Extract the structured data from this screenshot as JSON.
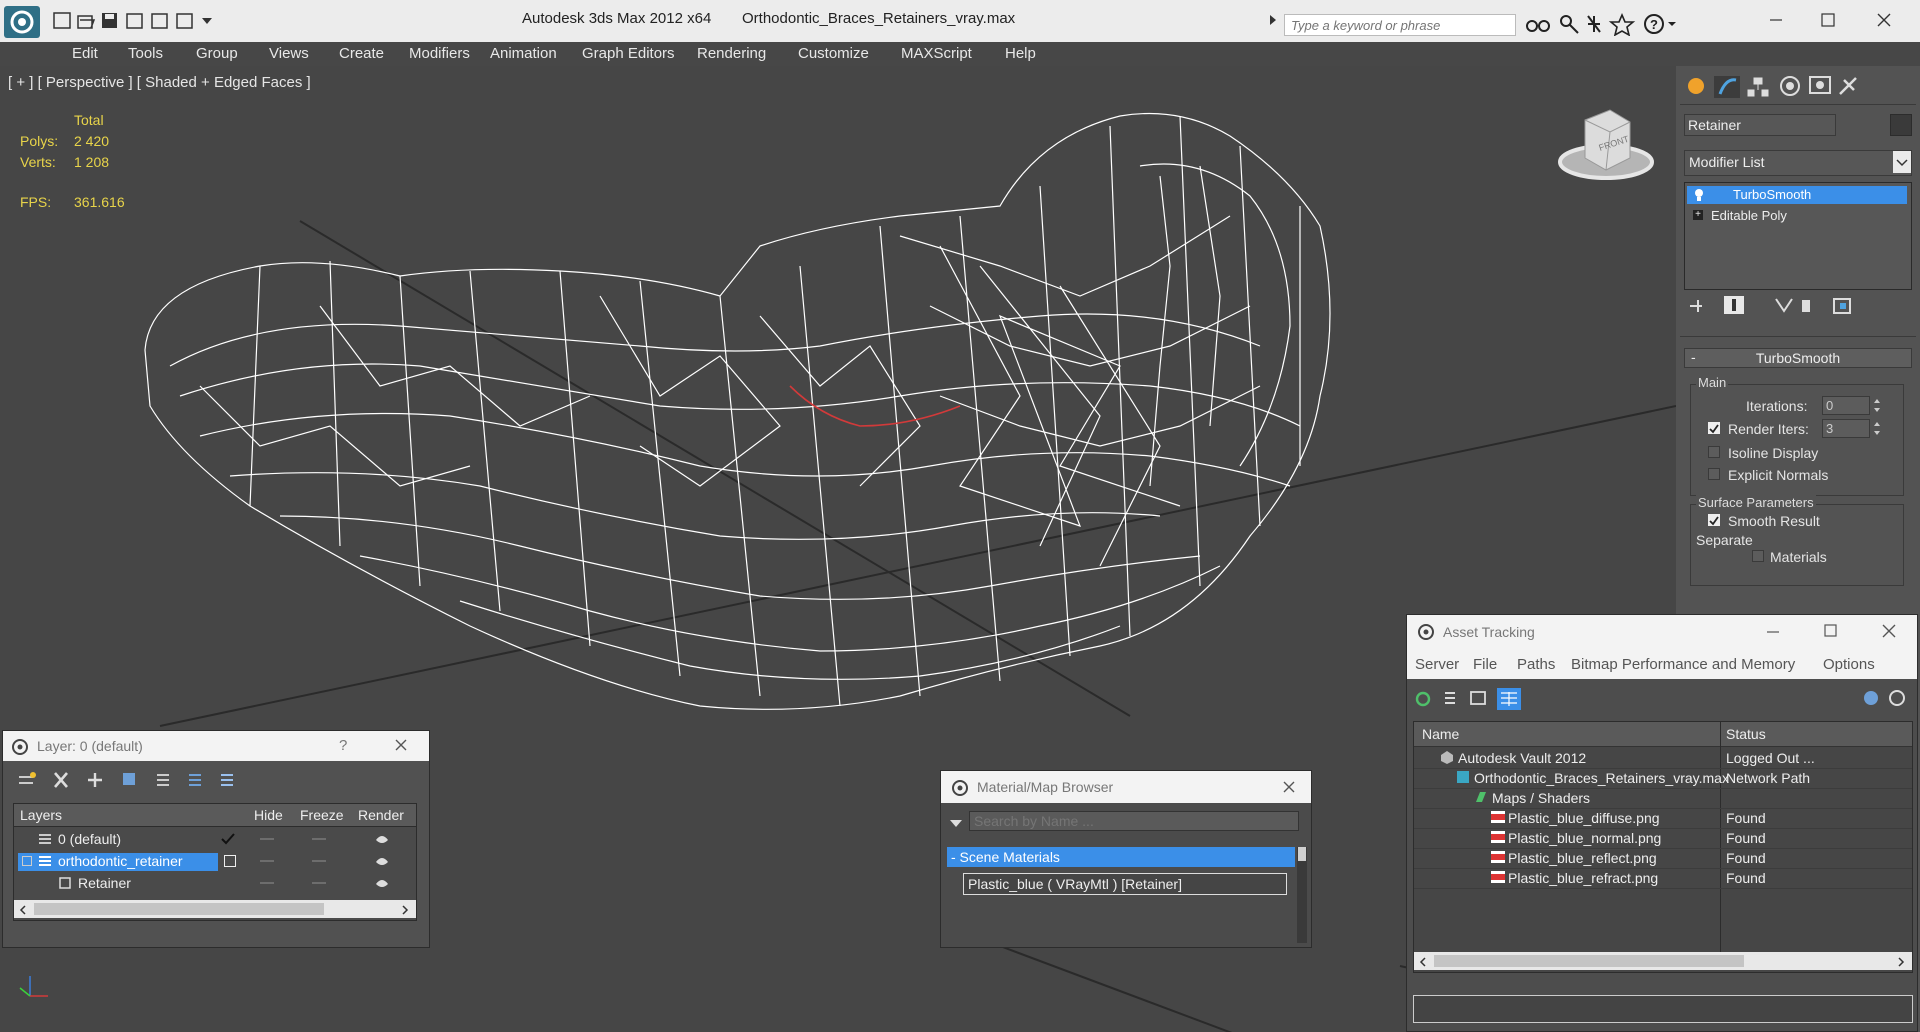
{
  "app": {
    "title": "Autodesk 3ds Max  2012 x64",
    "file": "Orthodontic_Braces_Retainers_vray.max",
    "search_placeholder": "Type a keyword or phrase",
    "help_label": "?"
  },
  "menu": [
    "Edit",
    "Tools",
    "Group",
    "Views",
    "Create",
    "Modifiers",
    "Animation",
    "Graph Editors",
    "Rendering",
    "Customize",
    "MAXScript",
    "Help"
  ],
  "viewport": {
    "label": "[ + ] [ Perspective ] [ Shaded + Edged Faces ]",
    "stats": {
      "total_label": "Total",
      "polys_label": "Polys:",
      "polys": "2 420",
      "verts_label": "Verts:",
      "verts": "1 208",
      "fps_label": "FPS:",
      "fps": "361.616"
    },
    "viewcube_label": "FRONT"
  },
  "command_panel": {
    "object_name": "Retainer",
    "modifier_list_label": "Modifier List",
    "stack": [
      "TurboSmooth",
      "Editable Poly"
    ],
    "rollout_title": "TurboSmooth",
    "main_group": "Main",
    "iterations_label": "Iterations:",
    "iterations_value": "0",
    "render_iters_label": "Render Iters:",
    "render_iters_value": "3",
    "render_iters_checked": true,
    "isoline_label": "Isoline Display",
    "explicit_normals_label": "Explicit Normals",
    "surface_group": "Surface Parameters",
    "smooth_result_label": "Smooth Result",
    "smooth_result_checked": true,
    "separate_label": "Separate",
    "materials_label": "Materials"
  },
  "layer_dialog": {
    "title": "Layer: 0 (default)",
    "help": "?",
    "columns": [
      "Layers",
      "Hide",
      "Freeze",
      "Render"
    ],
    "rows": [
      {
        "name": "0 (default)",
        "active": true
      },
      {
        "name": "orthodontic_retainer",
        "selected": true
      },
      {
        "name": "Retainer"
      }
    ]
  },
  "material_browser": {
    "title": "Material/Map Browser",
    "search_placeholder": "Search by Name ...",
    "section": "- Scene Materials",
    "item": "Plastic_blue  ( VRayMtl )  [Retainer]"
  },
  "asset_tracking": {
    "title": "Asset Tracking",
    "menu": [
      "Server",
      "File",
      "Paths",
      "Bitmap Performance and Memory",
      "Options"
    ],
    "columns": [
      "Name",
      "Status"
    ],
    "rows": [
      {
        "name": "Autodesk Vault 2012",
        "status": "Logged Out ..."
      },
      {
        "name": "Orthodontic_Braces_Retainers_vray.max",
        "status": "Network Path"
      },
      {
        "name": "Maps / Shaders",
        "status": ""
      },
      {
        "name": "Plastic_blue_diffuse.png",
        "status": "Found"
      },
      {
        "name": "Plastic_blue_normal.png",
        "status": "Found"
      },
      {
        "name": "Plastic_blue_reflect.png",
        "status": "Found"
      },
      {
        "name": "Plastic_blue_refract.png",
        "status": "Found"
      }
    ]
  },
  "colors": {
    "accent": "#3b8fe8",
    "stats_text": "#e8d44a",
    "viewport_bg": "#464646",
    "wire": "#ffffff"
  }
}
